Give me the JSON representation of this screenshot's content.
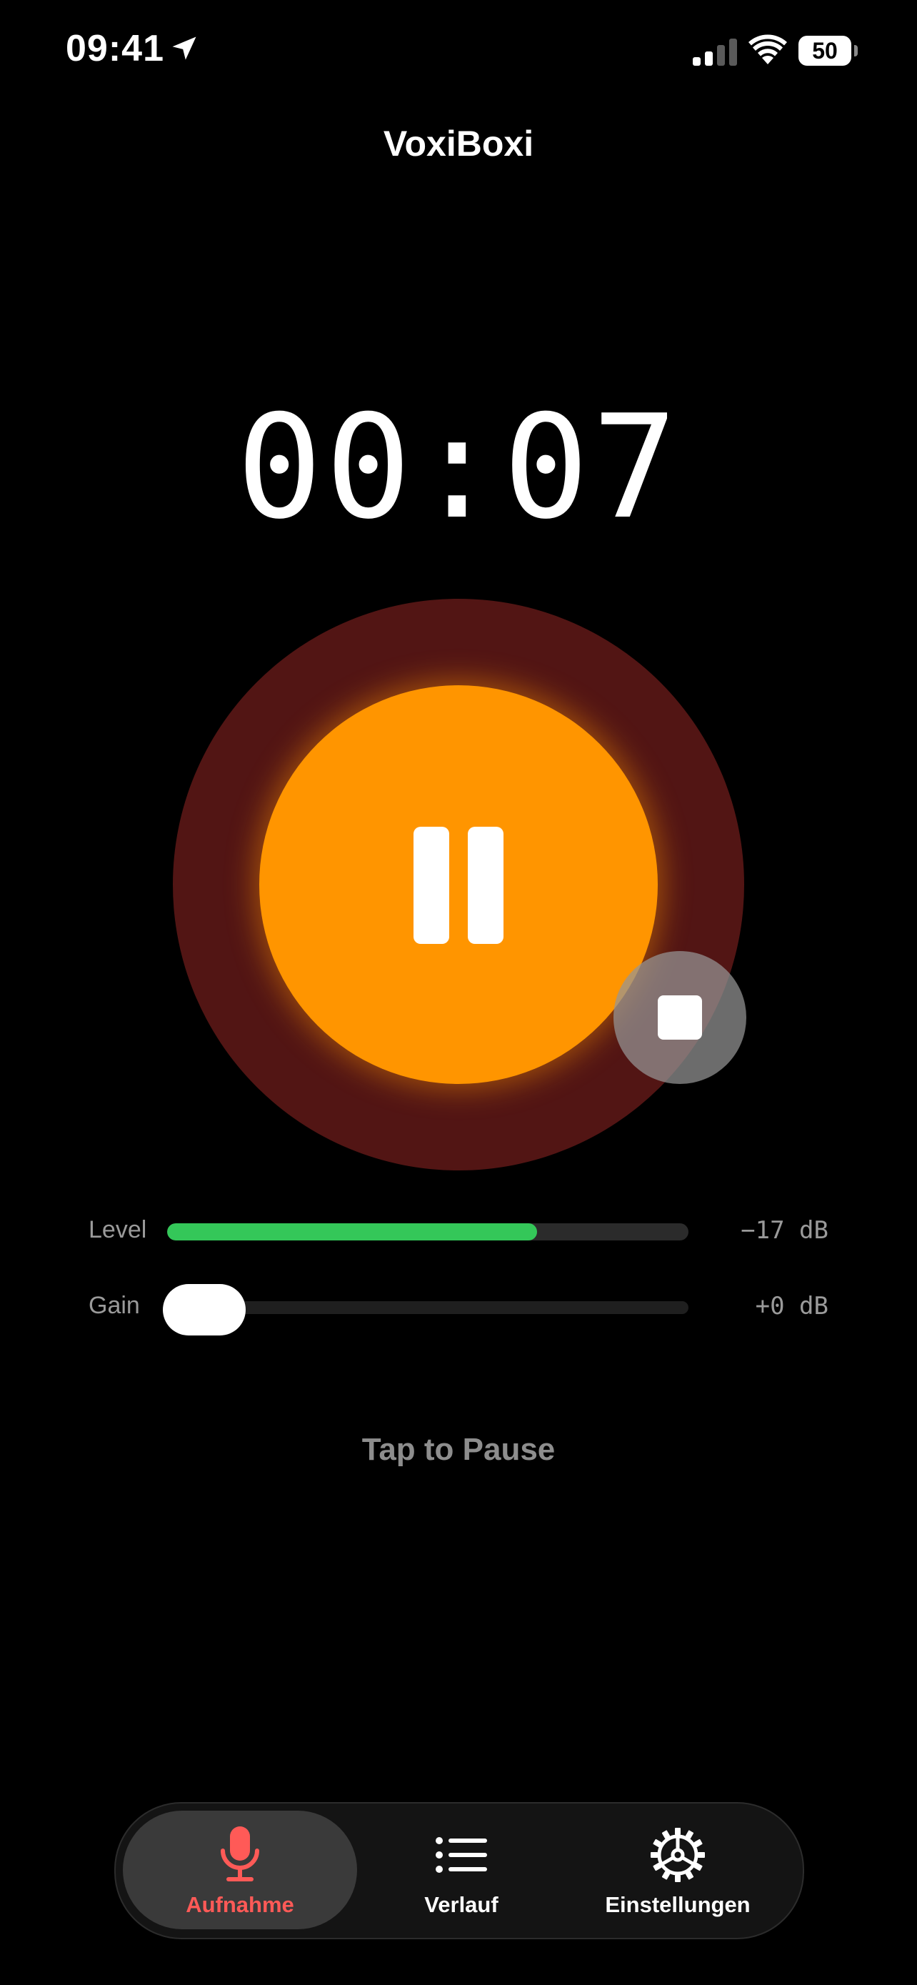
{
  "status_bar": {
    "time": "09:41",
    "battery_percent": "50",
    "icons": [
      "location-arrow-icon",
      "cellular-signal-icon",
      "wifi-icon",
      "battery-icon"
    ]
  },
  "header": {
    "title": "VoxiBoxi"
  },
  "recorder": {
    "elapsed": "00:07",
    "state": "recording",
    "primary_action_icon": "pause-icon",
    "secondary_action_icon": "stop-icon"
  },
  "meters": {
    "level": {
      "label": "Level",
      "value_text": "−17 dB",
      "fill_fraction": 0.71
    },
    "gain": {
      "label": "Gain",
      "value_text": "+0 dB",
      "position_fraction": 0.0
    }
  },
  "hint": "Tap to Pause",
  "colors": {
    "accent_orange": "#ff9500",
    "ring_dark_red": "#521514",
    "level_green": "#34c759",
    "active_tab_red": "#ff5a57"
  },
  "tab_bar": {
    "tabs": [
      {
        "label": "Aufnahme",
        "icon": "microphone-icon",
        "active": true
      },
      {
        "label": "Verlauf",
        "icon": "list-icon",
        "active": false
      },
      {
        "label": "Einstellungen",
        "icon": "gear-icon",
        "active": false
      }
    ]
  }
}
